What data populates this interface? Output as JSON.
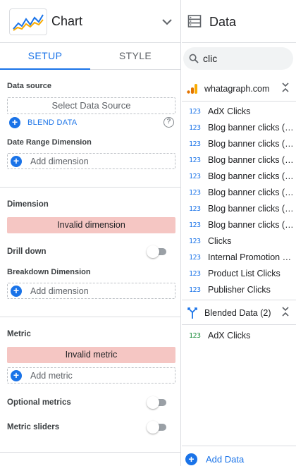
{
  "chart_panel": {
    "title": "Chart",
    "tabs": [
      {
        "label": "SETUP",
        "active": true
      },
      {
        "label": "STYLE",
        "active": false
      }
    ],
    "data_source": {
      "heading": "Data source",
      "select_label": "Select Data Source",
      "blend_label": "BLEND DATA",
      "help_icon": "help-icon"
    },
    "date_range": {
      "heading": "Date Range Dimension",
      "add_label": "Add dimension"
    },
    "dimension": {
      "heading": "Dimension",
      "error": "Invalid dimension",
      "drill_down_label": "Drill down",
      "drill_down_on": false,
      "breakdown_heading": "Breakdown Dimension",
      "breakdown_add_label": "Add dimension"
    },
    "metric": {
      "heading": "Metric",
      "error": "Invalid metric",
      "add_label": "Add metric",
      "optional_label": "Optional metrics",
      "optional_on": false,
      "sliders_label": "Metric sliders",
      "sliders_on": false
    }
  },
  "data_panel": {
    "title": "Data",
    "search": {
      "value": "clic"
    },
    "sources": [
      {
        "name": "whatagraph.com",
        "icon": "google-analytics-icon",
        "fields": [
          {
            "type": "123",
            "name": "AdX Clicks"
          },
          {
            "type": "123",
            "name": "Blog banner clicks (G..."
          },
          {
            "type": "123",
            "name": "Blog banner clicks (G..."
          },
          {
            "type": "123",
            "name": "Blog banner clicks (G..."
          },
          {
            "type": "123",
            "name": "Blog banner clicks (G..."
          },
          {
            "type": "123",
            "name": "Blog banner clicks (G..."
          },
          {
            "type": "123",
            "name": "Blog banner clicks (G..."
          },
          {
            "type": "123",
            "name": "Blog banner clicks (Si..."
          },
          {
            "type": "123",
            "name": "Clicks"
          },
          {
            "type": "123",
            "name": "Internal Promotion Cli..."
          },
          {
            "type": "123",
            "name": "Product List Clicks"
          },
          {
            "type": "123",
            "name": "Publisher Clicks"
          }
        ]
      },
      {
        "name": "Blended Data (2)",
        "icon": "blend-icon",
        "fields": [
          {
            "type": "123",
            "name": "AdX Clicks"
          }
        ]
      }
    ],
    "add_data_label": "Add Data"
  },
  "colors": {
    "accent": "#1a73e8",
    "error_bg": "#f5c6c3",
    "ga_orange": "#f9ab00",
    "ga_dark_orange": "#e37400",
    "blended_green": "#1e8e3e"
  }
}
